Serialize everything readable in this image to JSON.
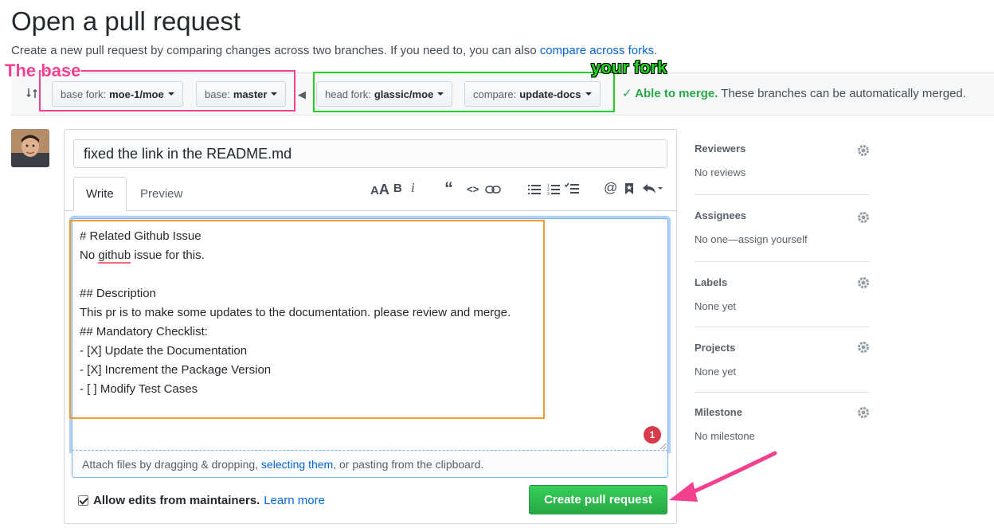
{
  "page": {
    "title": "Open a pull request",
    "subtitle_text": "Create a new pull request by comparing changes across two branches. If you need to, you can also ",
    "subtitle_link": "compare across forks",
    "subtitle_end": "."
  },
  "range": {
    "base_fork_label": "base fork:",
    "base_fork_value": "moe-1/moe",
    "base_label": "base:",
    "base_value": "master",
    "head_fork_label": "head fork:",
    "head_fork_value": "glassic/moe",
    "compare_label": "compare:",
    "compare_value": "update-docs",
    "merge_ok": "✓ Able to merge.",
    "merge_text": " These branches can be automatically merged."
  },
  "annotations": {
    "base": "The base",
    "fork": "your fork"
  },
  "form": {
    "title_value": "fixed the link in the README.md",
    "tab_write": "Write",
    "tab_preview": "Preview",
    "toolbar": [
      "AA",
      "B",
      "i",
      "“",
      "<>",
      "link",
      "ul",
      "ol",
      "task",
      "@",
      "bookmark",
      "reply"
    ],
    "body_lines": [
      "# Related Github Issue",
      "No github issue for this.",
      "",
      "## Description",
      "This pr is to make some updates to the documentation. please review and merge.",
      "## Mandatory Checklist:",
      "- [X] Update the Documentation",
      "- [X] Increment the Package Version",
      "- [ ] Modify Test Cases"
    ],
    "badge": "1",
    "attach_pre": "Attach files by dragging & dropping, ",
    "attach_link": "selecting them",
    "attach_post": ", or pasting from the clipboard.",
    "allow_label": "Allow edits from maintainers.",
    "learn_more": "Learn more",
    "create_button": "Create pull request"
  },
  "sidebar": {
    "reviewers": {
      "label": "Reviewers",
      "value": "No reviews"
    },
    "assignees": {
      "label": "Assignees",
      "value": "No one—assign yourself"
    },
    "labels": {
      "label": "Labels",
      "value": "None yet"
    },
    "projects": {
      "label": "Projects",
      "value": "None yet"
    },
    "milestone": {
      "label": "Milestone",
      "value": "No milestone"
    }
  },
  "colors": {
    "annotation_base": "#f4418f",
    "annotation_fork": "#22d022",
    "annotation_body": "#f59b2d",
    "create_button": "#28a745",
    "link": "#0366d6"
  }
}
